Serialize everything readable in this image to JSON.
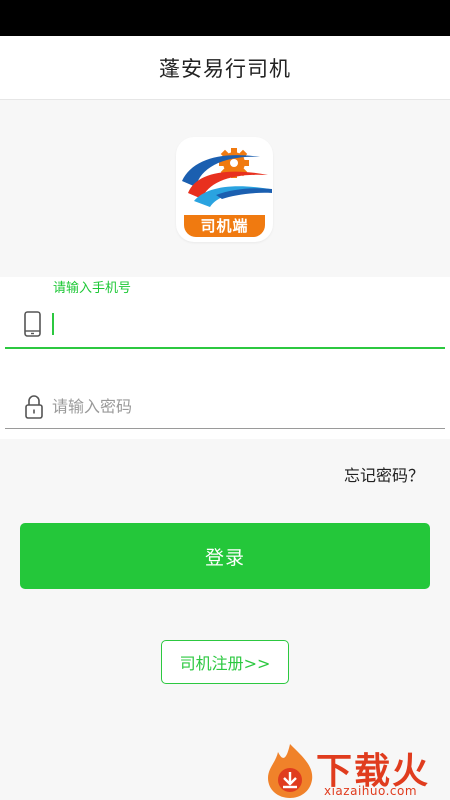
{
  "header": {
    "title": "蓬安易行司机"
  },
  "logo": {
    "badge_text": "司机端",
    "accent_orange": "#f07a10",
    "accent_blue": "#1b5fb0"
  },
  "form": {
    "phone": {
      "float_label": "请输入手机号",
      "value": ""
    },
    "password": {
      "placeholder": "请输入密码",
      "value": ""
    }
  },
  "links": {
    "forgot_password": "忘记密码？"
  },
  "buttons": {
    "login": "登录",
    "register": "司机注册>>"
  },
  "watermark": {
    "text": "下载火",
    "domain": "xiazaihuo.com"
  },
  "colors": {
    "primary_green": "#24c73a",
    "title_text": "#222222",
    "watermark_red": "#e03c1e"
  }
}
